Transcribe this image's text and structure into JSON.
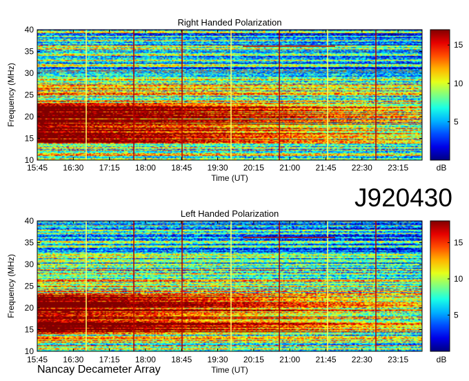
{
  "identifier": "J920430",
  "credit": "Nancay Decameter Array",
  "chart_data": [
    {
      "type": "heatmap",
      "title": "Right Handed Polarization",
      "xlabel": "Time (UT)",
      "ylabel": "Frequency (MHz)",
      "colorbar_label": "dB",
      "x_ticks": [
        "15:45",
        "16:30",
        "17:15",
        "18:00",
        "18:45",
        "19:30",
        "20:15",
        "21:00",
        "21:45",
        "22:30",
        "23:15"
      ],
      "x_range_minutes": [
        945,
        1425
      ],
      "y_ticks": [
        10,
        15,
        20,
        25,
        30,
        35,
        40
      ],
      "ylim": [
        10,
        40
      ],
      "colorbar_ticks": [
        5,
        10,
        15
      ],
      "zlim": [
        0,
        17
      ],
      "colormap": "jet"
    },
    {
      "type": "heatmap",
      "title": "Left Handed Polarization",
      "xlabel": "Time (UT)",
      "ylabel": "Frequency (MHz)",
      "colorbar_label": "dB",
      "x_ticks": [
        "15:45",
        "16:30",
        "17:15",
        "18:00",
        "18:45",
        "19:30",
        "20:15",
        "21:00",
        "21:45",
        "22:30",
        "23:15"
      ],
      "x_range_minutes": [
        945,
        1425
      ],
      "y_ticks": [
        10,
        15,
        20,
        25,
        30,
        35,
        40
      ],
      "ylim": [
        10,
        40
      ],
      "colorbar_ticks": [
        5,
        10,
        15
      ],
      "zlim": [
        0,
        18
      ],
      "colormap": "jet"
    }
  ]
}
